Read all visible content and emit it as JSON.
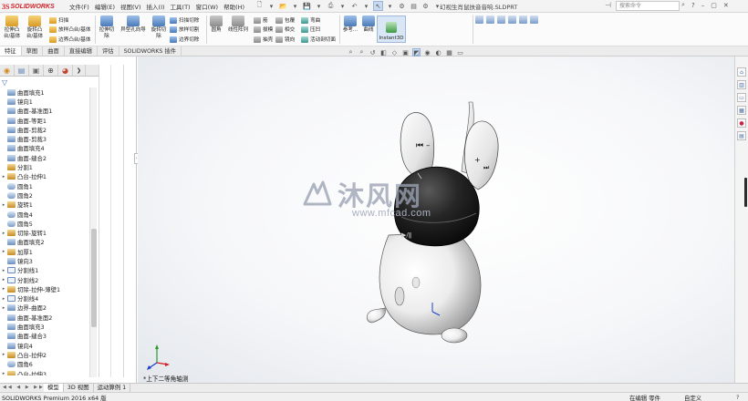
{
  "app": {
    "logo_ds": "3S",
    "logo_text": "SOLIDWORKS",
    "document_title": "幻视生肖鼠扶音音响.SLDPRT"
  },
  "menu": [
    "文件(F)",
    "编辑(E)",
    "视图(V)",
    "插入(I)",
    "工具(T)",
    "窗口(W)",
    "帮助(H)"
  ],
  "search": {
    "placeholder": "搜索命令"
  },
  "ribbon": {
    "extrude_boss": "拉伸凸\n台/基体",
    "revolve_boss": "旋转凸\n台/基体",
    "sweep": "扫描",
    "loft_boss": "放样凸台/基体",
    "boundary_boss": "边界凸台/基体",
    "extrude_cut": "拉伸切\n除",
    "hole_wizard": "异型孔向导",
    "revolve_cut": "旋转切\n除",
    "swept_cut": "扫描切除",
    "lofted_cut": "放样切割",
    "boundary_cut": "边界切除",
    "fillet": "圆角",
    "linear_pattern": "线性阵列",
    "rib": "筋",
    "draft": "拔模",
    "shell": "抽壳",
    "wrap": "包覆",
    "intersect": "相交",
    "mirror": "镜向",
    "dome": "弯曲",
    "indent": "压凹",
    "live_section": "活动剖切面",
    "reference": "参考...",
    "curves": "曲线",
    "instant3d": "Instant3D"
  },
  "tabs": [
    "特征",
    "草图",
    "曲面",
    "直接编辑",
    "评估",
    "SOLIDWORKS 插件"
  ],
  "active_tab": 0,
  "tree": [
    {
      "label": "曲面填充1",
      "icon": "surface-fill-icon"
    },
    {
      "label": "镜向1",
      "icon": "mirror-icon"
    },
    {
      "label": "曲面-基准面1",
      "icon": "planar-surface-icon"
    },
    {
      "label": "曲面-等距1",
      "icon": "offset-surface-icon"
    },
    {
      "label": "曲面-剪裁2",
      "icon": "trim-surface-icon"
    },
    {
      "label": "曲面-剪裁3",
      "icon": "trim-surface-icon"
    },
    {
      "label": "曲面填充4",
      "icon": "surface-fill-icon"
    },
    {
      "label": "曲面-缝合2",
      "icon": "knit-surface-icon"
    },
    {
      "label": "分割1",
      "icon": "split-icon"
    },
    {
      "label": "凸台-拉伸1",
      "icon": "boss-extrude-icon"
    },
    {
      "label": "圆角1",
      "icon": "fillet-icon"
    },
    {
      "label": "圆角2",
      "icon": "fillet-icon"
    },
    {
      "label": "旋转1",
      "icon": "revolve-icon"
    },
    {
      "label": "圆角4",
      "icon": "fillet-icon"
    },
    {
      "label": "圆角5",
      "icon": "fillet-icon"
    },
    {
      "label": "切除-旋转1",
      "icon": "cut-revolve-icon"
    },
    {
      "label": "曲面填充2",
      "icon": "surface-fill-icon"
    },
    {
      "label": "加厚1",
      "icon": "thicken-icon"
    },
    {
      "label": "镜向3",
      "icon": "mirror-icon"
    },
    {
      "label": "分割线1",
      "icon": "split-line-icon"
    },
    {
      "label": "分割线2",
      "icon": "split-line-icon"
    },
    {
      "label": "切除-拉伸-薄壁1",
      "icon": "cut-extrude-icon"
    },
    {
      "label": "分割线4",
      "icon": "split-line-icon"
    },
    {
      "label": "边界-曲面2",
      "icon": "boundary-surface-icon"
    },
    {
      "label": "曲面-基准面2",
      "icon": "planar-surface-icon"
    },
    {
      "label": "曲面填充3",
      "icon": "surface-fill-icon"
    },
    {
      "label": "曲面-缝合3",
      "icon": "knit-surface-icon"
    },
    {
      "label": "镜向4",
      "icon": "mirror-icon"
    },
    {
      "label": "凸台-拉伸2",
      "icon": "boss-extrude-icon"
    },
    {
      "label": "圆角6",
      "icon": "fillet-icon"
    },
    {
      "label": "凸台-拉伸3",
      "icon": "boss-extrude-icon"
    }
  ],
  "viewport": {
    "view_label": "*上下二等角轴测",
    "watermark_title": "沐风网",
    "watermark_url": "www.mfcad.com"
  },
  "bottom_tabs": [
    "模型",
    "3D 视图",
    "运动算例 1"
  ],
  "active_bottom_tab": 0,
  "status": {
    "app_version": "SOLIDWORKS Premium 2016 x64 版",
    "mode": "在编辑 零件",
    "units": "自定义",
    "help": "?"
  },
  "colors": {
    "brand_red": "#d12026",
    "viewport_bg": "#f4f6f8",
    "model_body": "#f2f2f2",
    "model_head": "#1c1c1c"
  }
}
